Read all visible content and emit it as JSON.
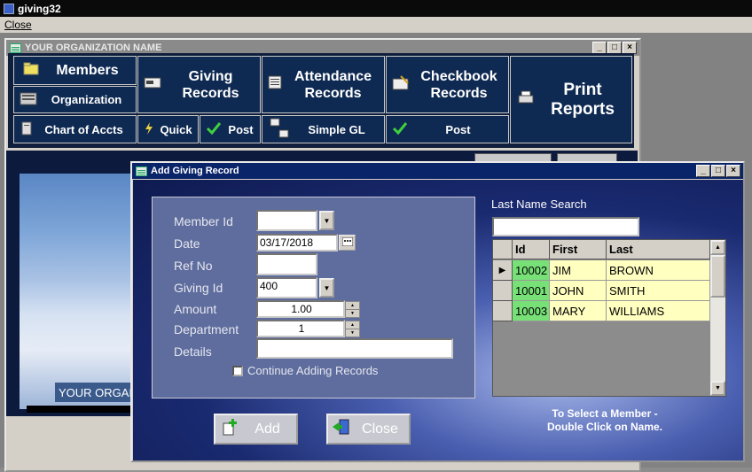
{
  "app": {
    "title": "giving32",
    "menu_close": "Close"
  },
  "org_window": {
    "title": "YOUR ORGANIZATION NAME",
    "banner": "YOUR ORGANIZATION NAME"
  },
  "window_buttons": {
    "minimize": "_",
    "maximize": "□",
    "close": "×"
  },
  "nav": {
    "members": "Members",
    "organization": "Organization",
    "chart_of_accts": "Chart of Accts",
    "giving_records": [
      "Giving",
      "Records"
    ],
    "quick": "Quick",
    "post1": "Post",
    "attendance_records": [
      "Attendance",
      "Records"
    ],
    "simple_gl": "Simple GL",
    "checkbook_records": [
      "Checkbook",
      "Records"
    ],
    "post2": "Post",
    "print_reports": [
      "Print",
      "Reports"
    ]
  },
  "giving_dialog": {
    "title": "Add Giving Record",
    "labels": {
      "member_id": "Member Id",
      "date": "Date",
      "ref_no": "Ref No",
      "giving_id": "Giving Id",
      "amount": "Amount",
      "department": "Department",
      "details": "Details"
    },
    "values": {
      "member_id": "",
      "date": "03/17/2018",
      "ref_no": "",
      "giving_id": "400",
      "amount": "1.00",
      "department": "1",
      "details": ""
    },
    "continue_label": "Continue Adding Records",
    "continue_checked": false,
    "add_button": "Add",
    "close_button": "Close",
    "search_label": "Last Name Search",
    "search_value": "",
    "grid": {
      "columns": [
        "Id",
        "First",
        "Last"
      ],
      "current_row_marker": "▶",
      "rows": [
        {
          "id": "10002",
          "first": "JIM",
          "last": "BROWN"
        },
        {
          "id": "10001",
          "first": "JOHN",
          "last": "SMITH"
        },
        {
          "id": "10003",
          "first": "MARY",
          "last": "WILLIAMS"
        }
      ]
    },
    "hint_line1": "To Select a Member -",
    "hint_line2": "Double Click on Name."
  },
  "colors": {
    "nav_bg": "#0f2a52",
    "dialog_title": "#0a246a",
    "id_cell": "#77e077",
    "row_cell": "#ffffc0"
  }
}
